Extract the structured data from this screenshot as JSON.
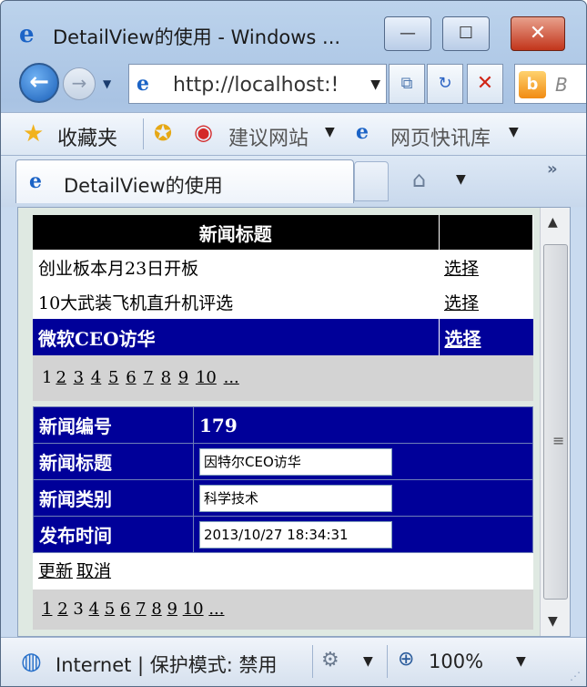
{
  "window": {
    "title": "DetailView的使用 - Windows ...",
    "min_label": "—",
    "max_label": "☐",
    "close_label": "✕"
  },
  "nav": {
    "address": "http://localhost:!",
    "search_placeholder": "B"
  },
  "favorites": {
    "label": "收藏夹",
    "suggested_sites": "建议网站",
    "web_slice_gallery": "网页快讯库"
  },
  "tab": {
    "title": "DetailView的使用"
  },
  "gridview": {
    "header": "新闻标题",
    "select_label": "选择",
    "rows": [
      {
        "title": "创业板本月23日开板"
      },
      {
        "title": "10大武装飞机直升机评选"
      },
      {
        "title": "微软CEO访华"
      }
    ],
    "pager": {
      "current": "1",
      "pages": [
        "2",
        "3",
        "4",
        "5",
        "6",
        "7",
        "8",
        "9",
        "10"
      ],
      "more": "..."
    }
  },
  "detailview": {
    "fields": [
      {
        "label": "新闻编号",
        "value": "179"
      },
      {
        "label": "新闻标题",
        "value": "因特尔CEO访华"
      },
      {
        "label": "新闻类别",
        "value": "科学技术"
      },
      {
        "label": "发布时间",
        "value": "2013/10/27 18:34:31"
      }
    ],
    "update_label": "更新",
    "cancel_label": "取消",
    "pager": {
      "pages": [
        "1",
        "2",
        "3",
        "4",
        "5",
        "6",
        "7",
        "8",
        "9",
        "10"
      ],
      "current_page": "3",
      "more": "..."
    }
  },
  "status": {
    "zone": "Internet | 保护模式: 禁用",
    "zoom": "100%"
  }
}
